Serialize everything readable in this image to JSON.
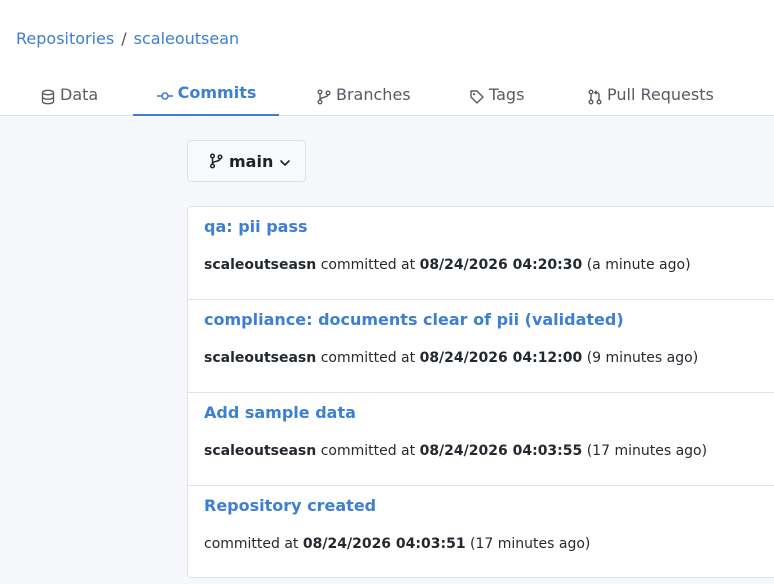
{
  "breadcrumb": {
    "root": "Repositories",
    "separator": "/",
    "repo": "scaleoutsean"
  },
  "tabs": [
    {
      "label": "Data",
      "icon": "database-icon"
    },
    {
      "label": "Commits",
      "icon": "commit-icon",
      "active": true
    },
    {
      "label": "Branches",
      "icon": "branch-icon"
    },
    {
      "label": "Tags",
      "icon": "tag-icon"
    },
    {
      "label": "Pull Requests",
      "icon": "pull-request-icon"
    }
  ],
  "branch_selector": {
    "label": "main"
  },
  "commits": [
    {
      "message": "qa: pii pass",
      "author": "scaleoutseasn",
      "committed_label": "committed at",
      "timestamp": "08/24/2026 04:20:30",
      "relative": "(a minute ago)"
    },
    {
      "message": "compliance: documents clear of pii (validated)",
      "author": "scaleoutseasn",
      "committed_label": "committed at",
      "timestamp": "08/24/2026 04:12:00",
      "relative": "(9 minutes ago)"
    },
    {
      "message": "Add sample data",
      "author": "scaleoutseasn",
      "committed_label": "committed at",
      "timestamp": "08/24/2026 04:03:55",
      "relative": "(17 minutes ago)"
    },
    {
      "message": "Repository created",
      "author": "",
      "committed_label": "committed at",
      "timestamp": "08/24/2026 04:03:51",
      "relative": "(17 minutes ago)"
    }
  ],
  "colors": {
    "accent": "#3d7fd1",
    "text": "#24292f",
    "muted": "#555c63",
    "border": "#dfe3e8",
    "page_bg": "#f5f7fa"
  }
}
